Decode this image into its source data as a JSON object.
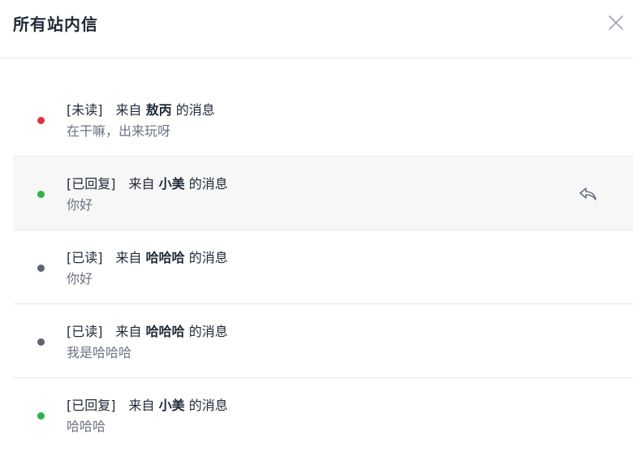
{
  "dialog": {
    "title": "所有站内信"
  },
  "labels": {
    "from_prefix": "来自",
    "from_suffix": "的消息"
  },
  "colors": {
    "unread": "#d9373a",
    "replied": "#2fb344",
    "read": "#5f6470",
    "reply_icon": "#6b7280"
  },
  "messages": [
    {
      "status": "[未读]",
      "sender": "敖丙",
      "content": "在干嘛，出来玩呀",
      "dot_color": "#d9373a",
      "has_reply_icon": false
    },
    {
      "status": "[已回复]",
      "sender": "小美",
      "content": "你好",
      "dot_color": "#2fb344",
      "has_reply_icon": true,
      "reply_icon": "reply-icon"
    },
    {
      "status": "[已读]",
      "sender": "哈哈哈",
      "content": "你好",
      "dot_color": "#5f6470",
      "has_reply_icon": false
    },
    {
      "status": "[已读]",
      "sender": "哈哈哈",
      "content": "我是哈哈哈",
      "dot_color": "#5f6470",
      "has_reply_icon": false
    },
    {
      "status": "[已回复]",
      "sender": "小美",
      "content": "哈哈哈",
      "dot_color": "#2fb344",
      "has_reply_icon": false
    }
  ]
}
